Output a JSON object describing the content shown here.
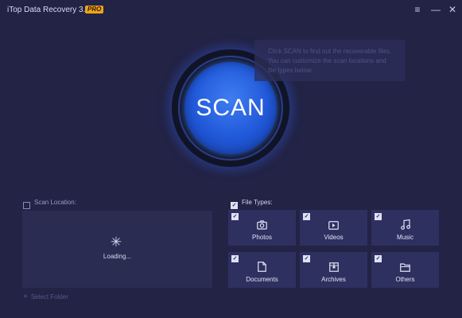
{
  "titlebar": {
    "app_title": "iTop Data Recovery 3.0",
    "badge": "PRO",
    "menu_glyph": "≡",
    "min_glyph": "—",
    "close_glyph": "✕"
  },
  "scan": {
    "button_label": "SCAN",
    "tooltip_lines": [
      "Click SCAN to find out the recoverable files.",
      "You can customize the scan locations and",
      "file types below."
    ]
  },
  "scan_location": {
    "label": "Scan Location:",
    "checked": false,
    "loading_text": "Loading...",
    "select_folder_label": "Select Folder"
  },
  "file_types": {
    "label": "File Types:",
    "checked": true,
    "tiles": [
      {
        "label": "Photos",
        "icon": "camera-icon",
        "checked": true
      },
      {
        "label": "Videos",
        "icon": "video-icon",
        "checked": true
      },
      {
        "label": "Music",
        "icon": "music-note-icon",
        "checked": true
      },
      {
        "label": "Documents",
        "icon": "document-icon",
        "checked": true
      },
      {
        "label": "Archives",
        "icon": "archive-icon",
        "checked": true
      },
      {
        "label": "Others",
        "icon": "folder-icon",
        "checked": true
      }
    ]
  },
  "colors": {
    "background": "#222345",
    "scan_button": "#2058d8",
    "pro_badge": "#f0a31b",
    "tile_bg": "#2e3060"
  }
}
